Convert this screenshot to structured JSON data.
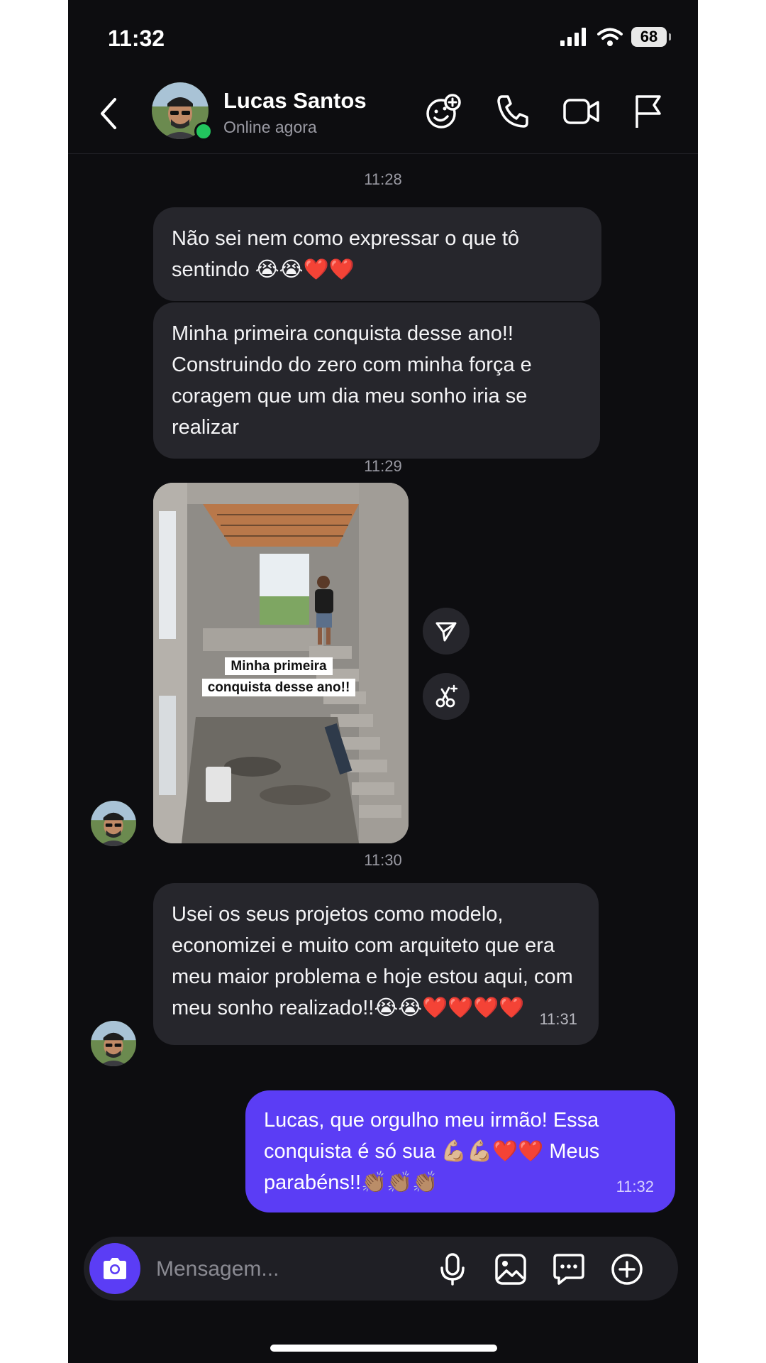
{
  "status_bar": {
    "time": "11:32",
    "battery": "68"
  },
  "header": {
    "name": "Lucas Santos",
    "status": "Online agora"
  },
  "messages": {
    "t1": "11:28",
    "m1": "Não sei nem como expressar o que tô sentindo 😭😭❤️❤️",
    "m2": "Minha primeira conquista desse ano!! Construindo do zero com minha força e coragem que um dia meu sonho iria se realizar",
    "t2": "11:29",
    "photo_caption_1": "Minha primeira",
    "photo_caption_2": "conquista desse ano!!",
    "t3": "11:30",
    "m3": "Usei os seus projetos como modelo, economizei e muito com arquiteto que era meu maior problema e hoje estou aqui, com meu sonho realizado!!😭😭❤️❤️❤️❤️",
    "m3_time": "11:31",
    "m4": "Lucas, que orgulho meu irmão! Essa conquista é só sua 💪🏼💪🏼❤️❤️ Meus parabéns!!👏🏽👏🏽👏🏽",
    "m4_time": "11:32"
  },
  "composer": {
    "placeholder": "Mensagem..."
  },
  "colors": {
    "accent": "#5b3df5",
    "background": "#0d0d10",
    "bubble_in": "#26262c",
    "online": "#22c55e"
  }
}
